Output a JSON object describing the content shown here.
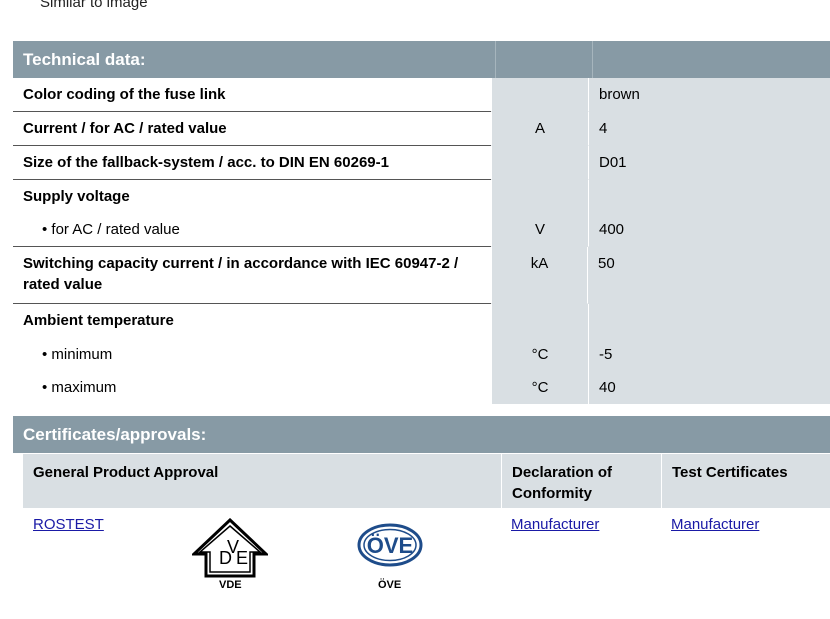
{
  "caption": "Similar to image",
  "technical": {
    "header": "Technical data:",
    "rows": [
      {
        "name": "Color coding of the fuse link",
        "unit": "",
        "value": "brown"
      },
      {
        "name": "Current / for AC / rated value",
        "unit": "A",
        "value": "4"
      },
      {
        "name": "Size of the fallback-system / acc. to DIN EN 60269-1",
        "unit": "",
        "value": "D01"
      },
      {
        "name": "Supply voltage",
        "unit": "",
        "value": ""
      },
      {
        "name": "• for AC / rated value",
        "unit": "V",
        "value": "400"
      },
      {
        "name": "Switching capacity current / in accordance with IEC 60947-2 / rated value",
        "unit": "kA",
        "value": "50"
      },
      {
        "name": "Ambient temperature",
        "unit": "",
        "value": ""
      },
      {
        "name": "• minimum",
        "unit": "°C",
        "value": "-5"
      },
      {
        "name": "• maximum",
        "unit": "°C",
        "value": "40"
      }
    ]
  },
  "certificates": {
    "header": "Certificates/approvals:",
    "col1": "General Product Approval",
    "col2": "Declaration of Conformity",
    "col3": "Test Certificates",
    "link1": "ROSTEST",
    "link2": "Manufacturer",
    "link3": "Manufacturer",
    "vde_label": "VDE",
    "ove_label": "ÖVE",
    "vde_letters": [
      "D",
      "V",
      "E"
    ],
    "ove_text": "ÖVE"
  }
}
